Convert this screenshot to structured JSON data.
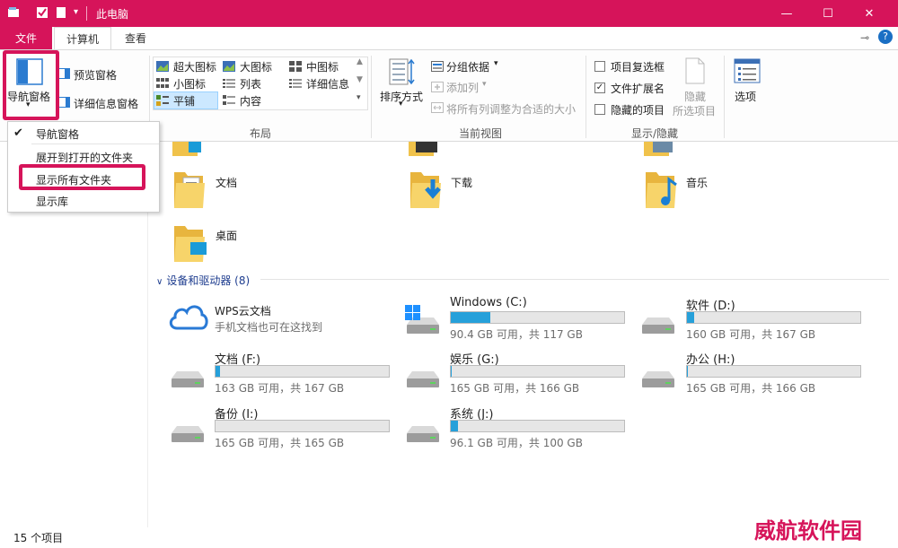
{
  "window": {
    "title": "此电脑",
    "controls": {
      "minimize": "—",
      "maximize": "☐",
      "close": "✕"
    }
  },
  "tabs": {
    "file": "文件",
    "computer": "计算机",
    "view": "查看"
  },
  "ribbon": {
    "pane": {
      "nav_pane": "导航窗格",
      "preview_pane": "预览窗格",
      "details_pane": "详细信息窗格"
    },
    "layout": {
      "group_label": "布局",
      "options": [
        "超大图标",
        "大图标",
        "中图标",
        "小图标",
        "列表",
        "详细信息",
        "平铺",
        "内容"
      ],
      "selected": "平铺"
    },
    "current_view": {
      "group_label": "当前视图",
      "sort_by": "排序方式",
      "group_by": "分组依据",
      "add_column": "添加列",
      "size_columns": "将所有列调整为合适的大小"
    },
    "show_hide": {
      "group_label": "显示/隐藏",
      "item_checkboxes": {
        "label": "项目复选框",
        "checked": false
      },
      "file_extensions": {
        "label": "文件扩展名",
        "checked": true
      },
      "hidden_items": {
        "label": "隐藏的项目",
        "checked": false
      },
      "hide_selected_line1": "隐藏",
      "hide_selected_line2": "所选项目"
    },
    "options": "选项"
  },
  "nav_menu": {
    "items": [
      {
        "label": "导航窗格",
        "checked": true
      },
      {
        "label": "展开到打开的文件夹",
        "checked": false
      },
      {
        "label": "显示所有文件夹",
        "checked": false
      },
      {
        "label": "显示库",
        "checked": false
      }
    ]
  },
  "folders": [
    {
      "name": "文档",
      "icon": "documents-folder-icon"
    },
    {
      "name": "下载",
      "icon": "downloads-folder-icon"
    },
    {
      "name": "音乐",
      "icon": "music-folder-icon"
    },
    {
      "name": "桌面",
      "icon": "desktop-folder-icon"
    }
  ],
  "devices_section": {
    "label": "设备和驱动器 (8)"
  },
  "wps": {
    "name": "WPS云文档",
    "subtitle": "手机文档也可在这找到"
  },
  "drives": [
    {
      "name": "Windows (C:)",
      "info": "90.4 GB 可用，共 117 GB",
      "used": 0.227
    },
    {
      "name": "软件 (D:)",
      "info": "160 GB 可用，共 167 GB",
      "used": 0.042
    },
    {
      "name": "文档 (F:)",
      "info": "163 GB 可用，共 167 GB",
      "used": 0.024
    },
    {
      "name": "娱乐 (G:)",
      "info": "165 GB 可用，共 166 GB",
      "used": 0.006
    },
    {
      "name": "办公 (H:)",
      "info": "165 GB 可用，共 166 GB",
      "used": 0.006
    },
    {
      "name": "备份 (I:)",
      "info": "165 GB 可用，共 165 GB",
      "used": 0.0
    },
    {
      "name": "系统 (J:)",
      "info": "96.1 GB 可用，共 100 GB",
      "used": 0.039
    }
  ],
  "status": {
    "item_count": "15 个项目"
  },
  "watermark": "威航软件园",
  "colors": {
    "accent": "#d6145a",
    "drive_fill": "#26a0da",
    "section_header": "#1e3d8f"
  }
}
